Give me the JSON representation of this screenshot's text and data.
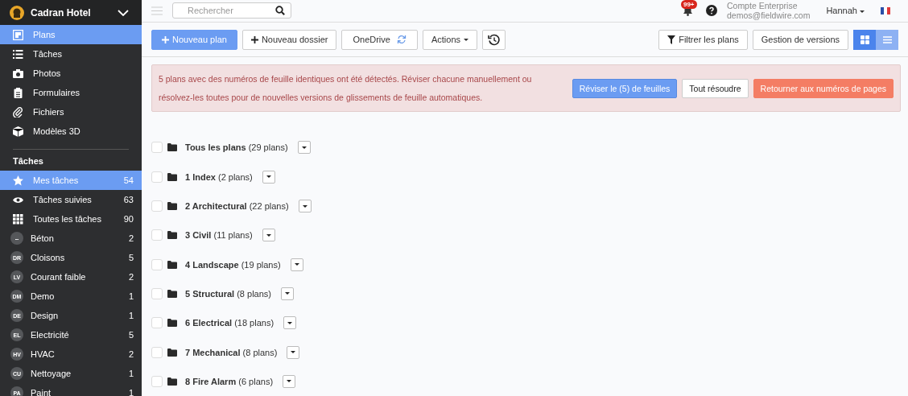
{
  "sidebar": {
    "project": "Cadran Hotel",
    "nav": [
      {
        "label": "Plans",
        "selected": true
      },
      {
        "label": "Tâches",
        "selected": false
      },
      {
        "label": "Photos",
        "selected": false
      },
      {
        "label": "Formulaires",
        "selected": false
      },
      {
        "label": "Fichiers",
        "selected": false
      },
      {
        "label": "Modèles 3D",
        "selected": false
      }
    ],
    "tasks_heading": "Tâches",
    "tasks": [
      {
        "kind": "icon",
        "label": "Mes tâches",
        "count": "54",
        "selected": true
      },
      {
        "kind": "icon",
        "label": "Tâches suivies",
        "count": "63",
        "selected": false
      },
      {
        "kind": "icon",
        "label": "Toutes les tâches",
        "count": "90",
        "selected": false
      },
      {
        "kind": "badge",
        "badge": "--",
        "label": "Béton",
        "count": "2",
        "selected": false
      },
      {
        "kind": "badge",
        "badge": "DR",
        "label": "Cloisons",
        "count": "5",
        "selected": false
      },
      {
        "kind": "badge",
        "badge": "LV",
        "label": "Courant faible",
        "count": "2",
        "selected": false
      },
      {
        "kind": "badge",
        "badge": "DM",
        "label": "Demo",
        "count": "1",
        "selected": false
      },
      {
        "kind": "badge",
        "badge": "DE",
        "label": "Design",
        "count": "1",
        "selected": false
      },
      {
        "kind": "badge",
        "badge": "EL",
        "label": "Electricité",
        "count": "5",
        "selected": false
      },
      {
        "kind": "badge",
        "badge": "HV",
        "label": "HVAC",
        "count": "2",
        "selected": false
      },
      {
        "kind": "badge",
        "badge": "CU",
        "label": "Nettoyage",
        "count": "1",
        "selected": false
      },
      {
        "kind": "badge",
        "badge": "PA",
        "label": "Paint",
        "count": "1",
        "selected": false
      }
    ]
  },
  "topbar": {
    "search": {
      "placeholder": "Rechercher"
    },
    "notifications": "99+",
    "account": "Compte Enterprise",
    "email": "demos@fieldwire.com",
    "user": "Hannah"
  },
  "toolbar": {
    "new_plan": "Nouveau plan",
    "new_folder": "Nouveau dossier",
    "onedrive": "OneDrive",
    "actions": "Actions",
    "filter": "Filtrer les plans",
    "versions": "Gestion de versions",
    "views": [
      {
        "kind": "grid",
        "selected": true
      },
      {
        "kind": "list",
        "selected": false
      }
    ]
  },
  "alert": {
    "message": "5 plans avec des numéros de feuille identiques ont été détectés. Réviser chacune manuellement ou résolvez-les toutes pour de nouvelles versions de glissements de feuille automatiques.",
    "review": "Réviser le (5) de feuilles",
    "resolve": "Tout résoudre",
    "revert": "Retourner aux numéros de pages"
  },
  "folders": [
    {
      "name": "Tous les plans",
      "count": "(29 plans)",
      "checked": false
    },
    {
      "name": "1 Index",
      "count": "(2 plans)",
      "checked": false
    },
    {
      "name": "2 Architectural",
      "count": "(22 plans)",
      "checked": false
    },
    {
      "name": "3 Civil",
      "count": "(11 plans)",
      "checked": false
    },
    {
      "name": "4 Landscape",
      "count": "(19 plans)",
      "checked": false
    },
    {
      "name": "5 Structural",
      "count": "(8 plans)",
      "checked": false
    },
    {
      "name": "6 Electrical",
      "count": "(18 plans)",
      "checked": false
    },
    {
      "name": "7 Mechanical",
      "count": "(8 plans)",
      "checked": false
    },
    {
      "name": "8 Fire Alarm",
      "count": "(6 plans)",
      "checked": false
    }
  ]
}
